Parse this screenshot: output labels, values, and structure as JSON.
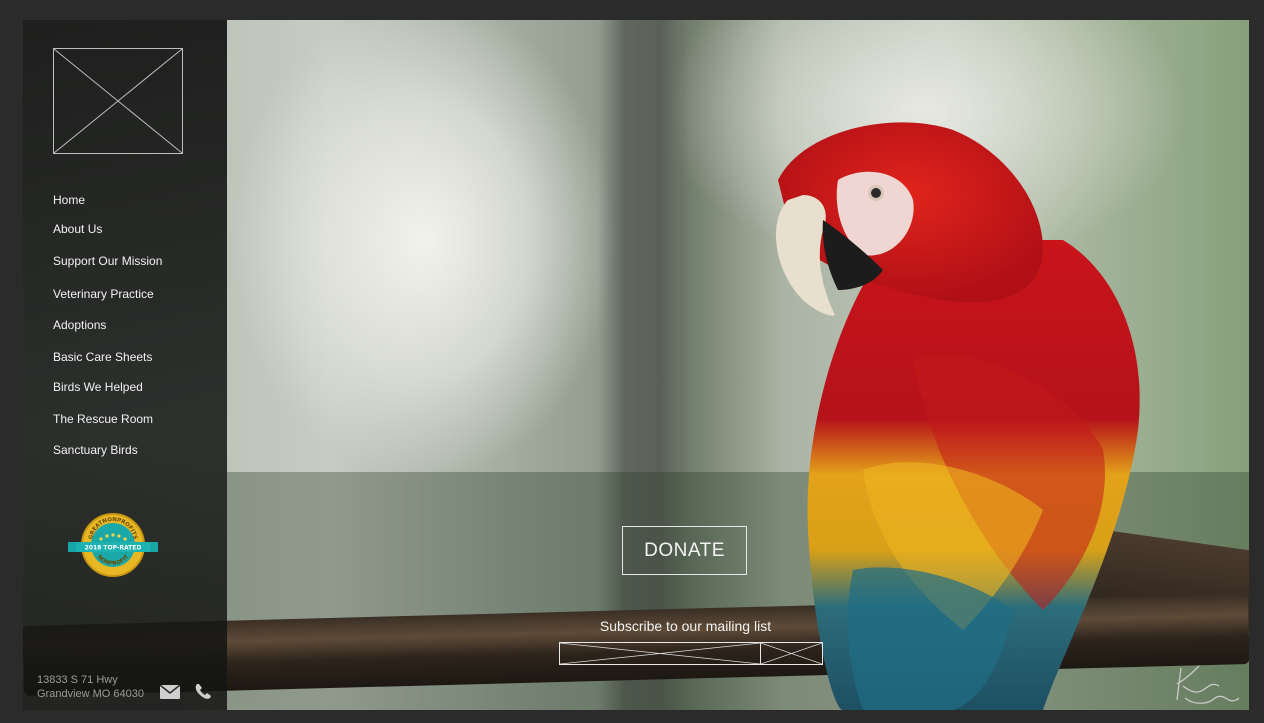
{
  "sidebar": {
    "nav": [
      {
        "label": "Home"
      },
      {
        "label": "About Us"
      },
      {
        "label": "Support Our Mission"
      },
      {
        "label": "Veterinary Practice"
      },
      {
        "label": "Adoptions"
      },
      {
        "label": "Basic Care Sheets"
      },
      {
        "label": "Birds We Helped"
      },
      {
        "label": "The Rescue Room"
      },
      {
        "label": "Sanctuary Birds"
      }
    ],
    "badge": {
      "arc_text": "GREATNONPROFITS",
      "ribbon_text": "2018 TOP-RATED",
      "bottom_text": "NONPROFIT"
    },
    "address": {
      "line1": "13833 S 71 Hwy",
      "line2": "Grandview MO 64030"
    },
    "icons": [
      "mail-icon",
      "phone-icon"
    ]
  },
  "main": {
    "donate_label": "DONATE",
    "subscribe_label": "Subscribe to our mailing list"
  },
  "colors": {
    "sidebar_bg": "#161616",
    "text": "#f2f2f2",
    "badge_gold": "#e8b824",
    "badge_teal": "#1aa8a8"
  }
}
